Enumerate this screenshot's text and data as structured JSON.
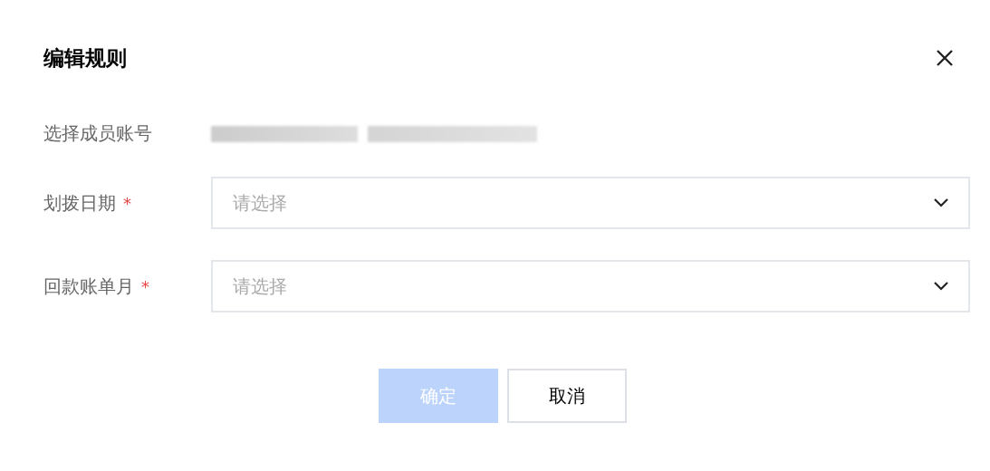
{
  "dialog": {
    "title": "编辑规则"
  },
  "fields": [
    {
      "kind": "text",
      "label": "选择成员账号"
    },
    {
      "kind": "select",
      "label": "划拨日期",
      "required_mark": "*",
      "placeholder": "请选择"
    },
    {
      "kind": "select",
      "label": "回款账单月",
      "required_mark": "*",
      "placeholder": "请选择"
    }
  ],
  "buttons": [
    {
      "label": "确定",
      "primary": true,
      "disabled": true
    },
    {
      "label": "取消",
      "primary": false,
      "disabled": false
    }
  ]
}
